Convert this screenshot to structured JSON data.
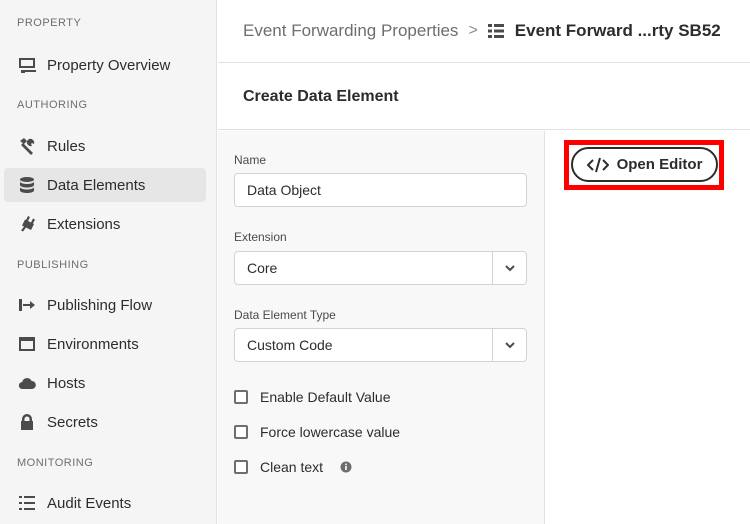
{
  "sidebar": {
    "sections": {
      "property": "PROPERTY",
      "authoring": "AUTHORING",
      "publishing": "PUBLISHING",
      "monitoring": "MONITORING"
    },
    "items": {
      "property_overview": "Property Overview",
      "rules": "Rules",
      "data_elements": "Data Elements",
      "extensions": "Extensions",
      "publishing_flow": "Publishing Flow",
      "environments": "Environments",
      "hosts": "Hosts",
      "secrets": "Secrets",
      "audit_events": "Audit Events"
    },
    "active_item": "Data Elements"
  },
  "breadcrumb": {
    "parent": "Event Forwarding Properties",
    "current": "Event Forward ...rty SB52"
  },
  "page": {
    "title": "Create Data Element"
  },
  "form": {
    "name_label": "Name",
    "name_value": "Data Object",
    "extension_label": "Extension",
    "extension_value": "Core",
    "type_label": "Data Element Type",
    "type_value": "Custom Code",
    "checkboxes": {
      "default_value": "Enable Default Value",
      "lowercase": "Force lowercase value",
      "clean_text": "Clean text"
    }
  },
  "editor": {
    "open_label": "Open Editor"
  },
  "colors": {
    "highlight": "#ff0000",
    "sidebar_bg": "#f5f5f5",
    "active_bg": "#e6e6e6"
  }
}
